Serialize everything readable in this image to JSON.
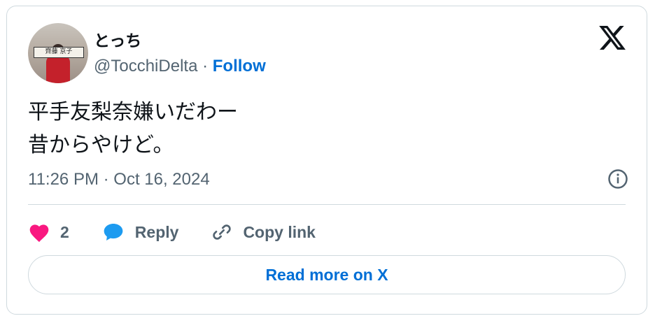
{
  "tweet": {
    "author_name": "とっち",
    "handle": "@TocchiDelta",
    "separator": " · ",
    "follow_label": "Follow",
    "avatar_banner_text": "齊藤 京子",
    "text_line1": "平手友梨奈嫌いだわー",
    "text_line2": "昔からやけど。",
    "timestamp": "11:26 PM · Oct 16, 2024"
  },
  "actions": {
    "like_count": "2",
    "reply_label": "Reply",
    "copy_link_label": "Copy link"
  },
  "footer": {
    "read_more_label": "Read more on X"
  },
  "icons": {
    "logo": "x-logo-icon",
    "info": "info-icon",
    "like": "heart-icon",
    "reply": "speech-bubble-icon",
    "copy_link": "link-icon"
  },
  "colors": {
    "link_blue": "#006fd6",
    "heart_red": "#f91880",
    "reply_blue": "#1d9bf0",
    "muted_text": "#536471"
  }
}
